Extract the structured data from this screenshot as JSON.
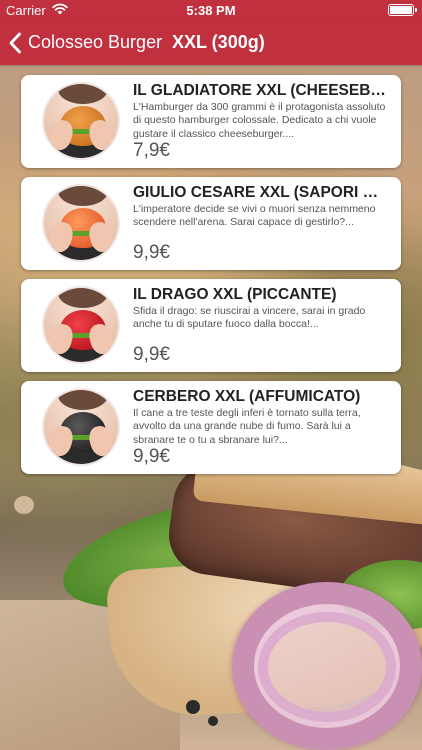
{
  "status_bar": {
    "carrier": "Carrier",
    "time": "5:38 PM",
    "wifi_icon": "wifi-icon",
    "battery_icon": "battery-full-icon"
  },
  "nav": {
    "back_label": "Colosseo Burger",
    "back_icon": "chevron-left-icon",
    "title": "XXL (300g)"
  },
  "colors": {
    "accent": "#c0303f",
    "card_bg": "#ffffff",
    "price_text": "#555555"
  },
  "items": [
    {
      "title": "IL GLADIATORE XXL (CHEESEBUR...",
      "description": "L'Hamburger da 300 grammi è il protagonista assoluto di questo hamburger colossale. Dedicato a chi vuole gustare il classico cheeseburger....",
      "price": "7,9€",
      "image": "burger-classic-photo"
    },
    {
      "title": "GIULIO CESARE XXL (SAPORI DI...",
      "description": "L'imperatore decide se vivi o muori senza nemmeno scendere nell'arena. Sarai capace di gestirlo?...",
      "price": "9,9€",
      "image": "burger-orange-photo"
    },
    {
      "title": "IL DRAGO XXL (PICCANTE)",
      "description": "Sfida il drago: se riuscirai a vincere, sarai in grado anche tu di sputare fuoco dalla bocca!...",
      "price": "9,9€",
      "image": "burger-red-photo"
    },
    {
      "title": "CERBERO XXL (AFFUMICATO)",
      "description": "Il cane a tre teste degli inferi è tornato sulla terra, avvolto da una grande nube di fumo. Sarà lui a sbranare te o tu a sbranare lui?...",
      "price": "9,9€",
      "image": "burger-black-photo"
    }
  ]
}
